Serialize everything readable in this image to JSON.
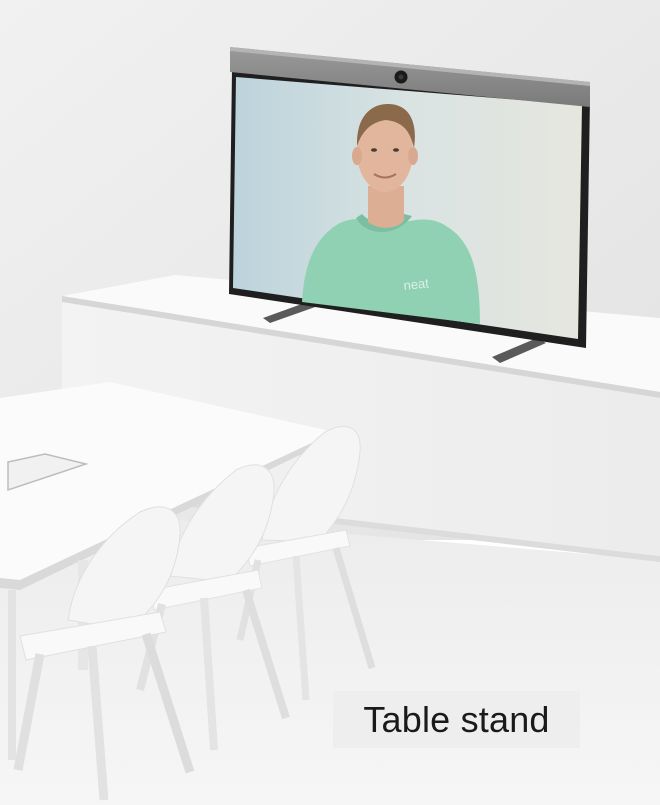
{
  "caption": {
    "text": "Table stand"
  },
  "screen": {
    "shirt_logo_text": "neat"
  },
  "colors": {
    "wall": "#eaeaea",
    "floor": "#f2f2f2",
    "furniture": "#f7f7f7",
    "device_frame": "#222222",
    "camera_bar": "#8a8a8a",
    "shirt": "#8fd1b2",
    "caption_bg": "#eeeeee"
  }
}
